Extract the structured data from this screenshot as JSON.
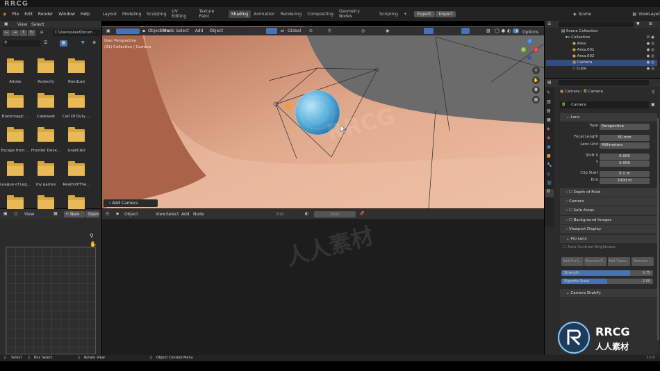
{
  "watermarks": {
    "top_left": "RRCG",
    "center_en": "RRCG",
    "center_cn": "人人素材",
    "logo_en": "RRCG",
    "logo_cn": "人人素材"
  },
  "topbar": {
    "menus": [
      "File",
      "Edit",
      "Render",
      "Window",
      "Help"
    ],
    "workspaces": [
      "Layout",
      "Modeling",
      "Sculpting",
      "UV Editing",
      "Texture Paint",
      "Shading",
      "Animation",
      "Rendering",
      "Compositing",
      "Geometry Nodes",
      "Scripting"
    ],
    "active_workspace": "Shading",
    "add_tab": "+",
    "export": "Export",
    "import": "Import",
    "scene": "Scene",
    "view_layer": "ViewLayer"
  },
  "filebrowser": {
    "view": "View",
    "select": "Select",
    "path": "C:\\Users\\okeefDocum...",
    "folders": [
      "Adobe",
      "Audacity",
      "BandLab",
      "Blackmagic ...",
      "Cakewalk",
      "Call Of Duty ...",
      "Escape from ...",
      "Frontier Deve...",
      "GrabCAD",
      "League of Leg...",
      "my games",
      "RealmOfThe..."
    ]
  },
  "image_editor": {
    "view": "View",
    "new": "New",
    "open": "Open"
  },
  "viewport": {
    "mode": "Object Mode",
    "menus": [
      "View",
      "Select",
      "Add",
      "Object"
    ],
    "transform": "Global",
    "options": "Options",
    "overlay_line1": "User Perspective",
    "overlay_line2": "(31) Collection | Camera",
    "last_op": "Add Camera",
    "axes": {
      "x": "X",
      "y": "Y",
      "z": "Z"
    }
  },
  "node_editor": {
    "object": "Object",
    "menus": [
      "View",
      "Select",
      "Add",
      "Node"
    ],
    "slot": "Slot",
    "new": "New"
  },
  "outliner": {
    "root": "Scene Collection",
    "collection": "Collection",
    "items": [
      "Area",
      "Area.001",
      "Area.002",
      "Camera",
      "Cube"
    ],
    "selected": "Camera"
  },
  "properties": {
    "breadcrumb_obj": "Camera",
    "breadcrumb_data": "Camera",
    "datablock": "Camera",
    "lens_header": "Lens",
    "type_label": "Type",
    "type_value": "Perspective",
    "focal_label": "Focal Length",
    "focal_value": "50 mm",
    "lens_unit_label": "Lens Unit",
    "lens_unit_value": "Millimeters",
    "shift_x_label": "Shift X",
    "shift_x_value": "0.000",
    "shift_y_label": "Y",
    "shift_y_value": "0.000",
    "clip_start_label": "Clip Start",
    "clip_start_value": "0.1 m",
    "clip_end_label": "End",
    "clip_end_value": "1000 m",
    "panels": [
      "Depth of Field",
      "Camera",
      "Safe Areas",
      "Background Images",
      "Viewport Display"
    ],
    "pro_lens": "Pro Lens",
    "auto_contrast": "Auto Contrast Brightness",
    "buttons": [
      "Add Pro L...",
      "Remove P...",
      "Add Vigne...",
      "Remove ..."
    ],
    "strength_label": "Strength",
    "strength_value": "0.75",
    "strength_fraction": 0.75,
    "vignette_label": "Vignette Scale",
    "vignette_value": "2.00",
    "vignette_fraction": 0.5,
    "shakify": "Camera Shakify"
  },
  "statusbar": {
    "select": "Select",
    "box_select": "Box Select",
    "rotate": "Rotate View",
    "context": "Object Context Menu",
    "version": "3.0.0"
  }
}
